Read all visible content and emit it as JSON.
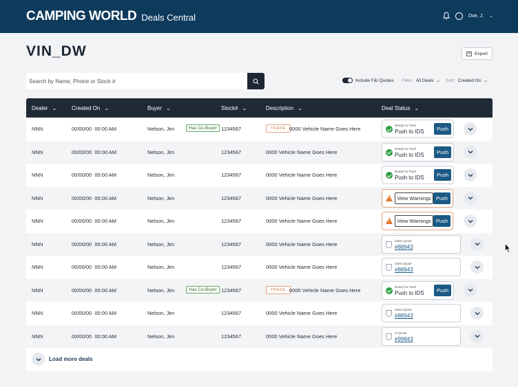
{
  "header": {
    "brand": "CAMPING WORLD",
    "product": "Deals Central",
    "user": "Doe, J."
  },
  "page": {
    "title": "VIN_DW",
    "export_label": "Export"
  },
  "search": {
    "placeholder": "Search by Name, Phone or Stock #"
  },
  "filters": {
    "include_fi_label": "Include F&I Quotes",
    "include_fi_on": true,
    "filter_label": "Filter:",
    "filter_value": "All Deals",
    "sort_label": "Sort:",
    "sort_value": "Created On"
  },
  "table": {
    "columns": [
      "Dealer",
      "Created On",
      "Buyer",
      "Stock#",
      "Description",
      "Deal Status"
    ],
    "rows": [
      {
        "dealer": "NNN",
        "created": "00/00/00  00:00 AM",
        "buyer": "Nelson, Jim",
        "co_buyer": "Has Co-Buyer",
        "stock": "1234567",
        "trade": "TRADE",
        "description": "0000 Vehicle Name Goes Here",
        "status": "push",
        "status_label": "Ready for Push",
        "status_text": "Push to IDS",
        "action": "Push"
      },
      {
        "dealer": "NNN",
        "created": "00/00/00  00:00 AM",
        "buyer": "Nelson, Jim",
        "co_buyer": "",
        "stock": "1234567",
        "trade": "",
        "description": "0000 Vehicle Name Goes Here",
        "status": "push",
        "status_label": "Ready for Push",
        "status_text": "Push to IDS",
        "action": "Push"
      },
      {
        "dealer": "NNN",
        "created": "00/00/00  00:00 AM",
        "buyer": "Nelson, Jim",
        "co_buyer": "",
        "stock": "1234567",
        "trade": "",
        "description": "0000 Vehicle Name Goes Here",
        "status": "push",
        "status_label": "Ready for Push",
        "status_text": "Push to IDS",
        "action": "Push"
      },
      {
        "dealer": "NNN",
        "created": "00/00/00  00:00 AM",
        "buyer": "Nelson, Jim",
        "co_buyer": "",
        "stock": "1234567",
        "trade": "",
        "description": "0000 Vehicle Name Goes Here",
        "status": "warn",
        "status_text": "View Warnings",
        "action": "Push"
      },
      {
        "dealer": "NNN",
        "created": "00/00/00  00:00 AM",
        "buyer": "Nelson, Jim",
        "co_buyer": "",
        "stock": "1234567",
        "trade": "",
        "description": "0000 Vehicle Name Goes Here",
        "status": "warn",
        "status_text": "View Warnings",
        "action": "Push"
      },
      {
        "dealer": "NNN",
        "created": "00/00/00  00:00 AM",
        "buyer": "Nelson, Jim",
        "co_buyer": "",
        "stock": "1234567",
        "trade": "",
        "description": "0000 Vehicle Name Goes Here",
        "status": "quote",
        "status_label": "Sales Quote",
        "status_text": "#88943"
      },
      {
        "dealer": "NNN",
        "created": "00/00/00  00:00 AM",
        "buyer": "Nelson, Jim",
        "co_buyer": "",
        "stock": "1234567",
        "trade": "",
        "description": "0000 Vehicle Name Goes Here",
        "status": "quote",
        "status_label": "Sales Quote",
        "status_text": "#88943"
      },
      {
        "dealer": "NNN",
        "created": "00/00/00  00:00 AM",
        "buyer": "Nelson, Jim",
        "co_buyer": "Has Co-Buyer",
        "stock": "1234567",
        "trade": "TRADE",
        "description": "0000 Vehicle Name Goes Here",
        "status": "push",
        "status_label": "Ready for Push",
        "status_text": "Push to IDS",
        "action": "Push"
      },
      {
        "dealer": "NNN",
        "created": "00/00/00  00:00 AM",
        "buyer": "Nelson, Jim",
        "co_buyer": "",
        "stock": "1234567",
        "trade": "",
        "description": "0000 Vehicle Name Goes Here",
        "status": "quote",
        "status_label": "Sales Quote",
        "status_text": "#88943"
      },
      {
        "dealer": "NNN",
        "created": "00/00/00  00:00 AM",
        "buyer": "Nelson, Jim",
        "co_buyer": "",
        "stock": "1234567",
        "trade": "",
        "description": "0000 Vehicle Name Goes Here",
        "status": "quote",
        "status_label": "FI Quote",
        "status_text": "#99843"
      }
    ],
    "load_more_label": "Load more deals"
  },
  "colors": {
    "header_bg": "#0e3a5c",
    "table_header_bg": "#1f2a36",
    "push_button": "#1c5a85",
    "ready_green": "#2f9e44",
    "warning_orange": "#e07b2e",
    "cobuyer_green": "#5ea85e"
  }
}
